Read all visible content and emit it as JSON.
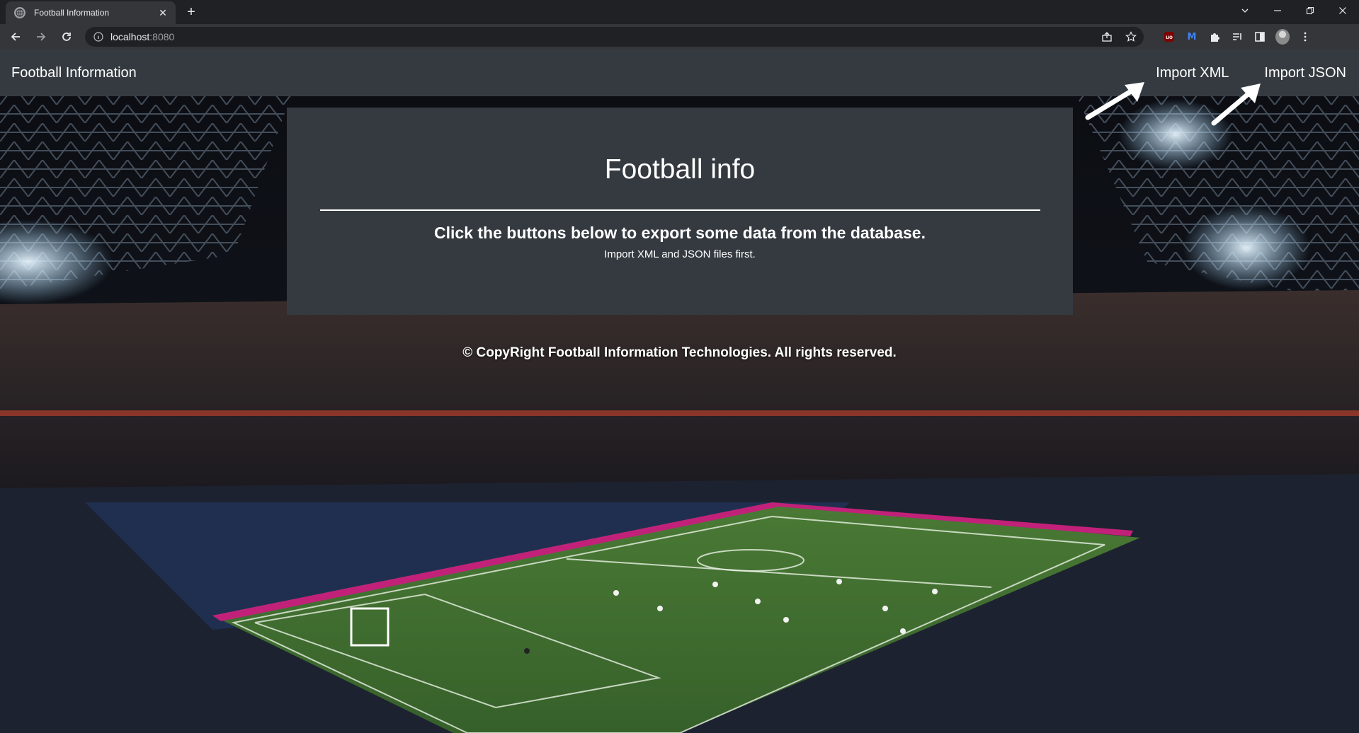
{
  "browser": {
    "tab_title": "Football Information",
    "tab_close": "✕",
    "new_tab": "+",
    "url_host": "localhost",
    "url_port": ":8080"
  },
  "navbar": {
    "brand": "Football Information",
    "links": [
      {
        "label": "Import XML"
      },
      {
        "label": "Import JSON"
      }
    ]
  },
  "card": {
    "title": "Football info",
    "lead": "Click the buttons below to export some data from the database.",
    "note": "Import XML and JSON files first."
  },
  "footer": {
    "text": "© CopyRight Football Information Technologies. All rights reserved."
  },
  "colors": {
    "navbar_bg": "#343a40",
    "card_bg": "#343a40",
    "text": "#ffffff",
    "pitch_green": "#3f6a2c"
  }
}
